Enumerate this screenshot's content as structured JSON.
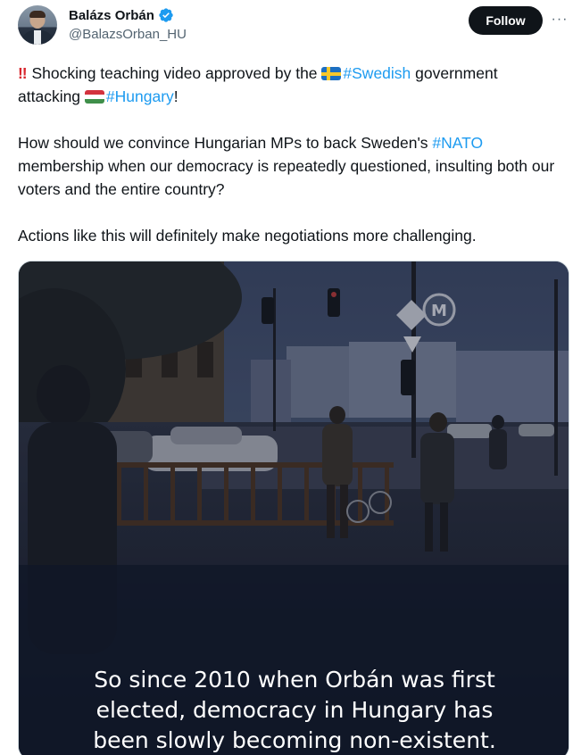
{
  "author": {
    "display_name": "Balázs Orbán",
    "handle": "@BalazsOrban_HU",
    "verified": true,
    "avatar_icon": "profile-photo"
  },
  "actions": {
    "follow_label": "Follow",
    "more_label": "···"
  },
  "tweet": {
    "line1_prefix": "Shocking teaching video approved by the ",
    "hashtag_swedish": "#Swedish",
    "line1_suffix": " government",
    "line2_prefix": "attacking ",
    "hashtag_hungary": "#Hungary",
    "line2_suffix": "!",
    "para2_prefix": "How should we convince Hungarian MPs to back Sweden's ",
    "hashtag_nato": "#NATO",
    "para2_suffix": " membership when our democracy is repeatedly questioned, insulting both our voters and the entire country?",
    "para3": "Actions like this will definitely make negotiations more challenging.",
    "emphasis_icon": "double-exclamation-icon",
    "flag_se_icon": "sweden-flag-icon",
    "flag_hu_icon": "hungary-flag-icon"
  },
  "media": {
    "caption_line1": "So since 2010 when Orbán was first",
    "caption_line2": "elected, democracy in Hungary has",
    "caption_line3": "been slowly becoming non-existent.",
    "metro_sign_letter": "M"
  },
  "colors": {
    "link": "#1d9bf0",
    "text": "#0f1419",
    "secondary": "#536471",
    "follow_bg": "#0f1419",
    "verified": "#1d9bf0"
  }
}
